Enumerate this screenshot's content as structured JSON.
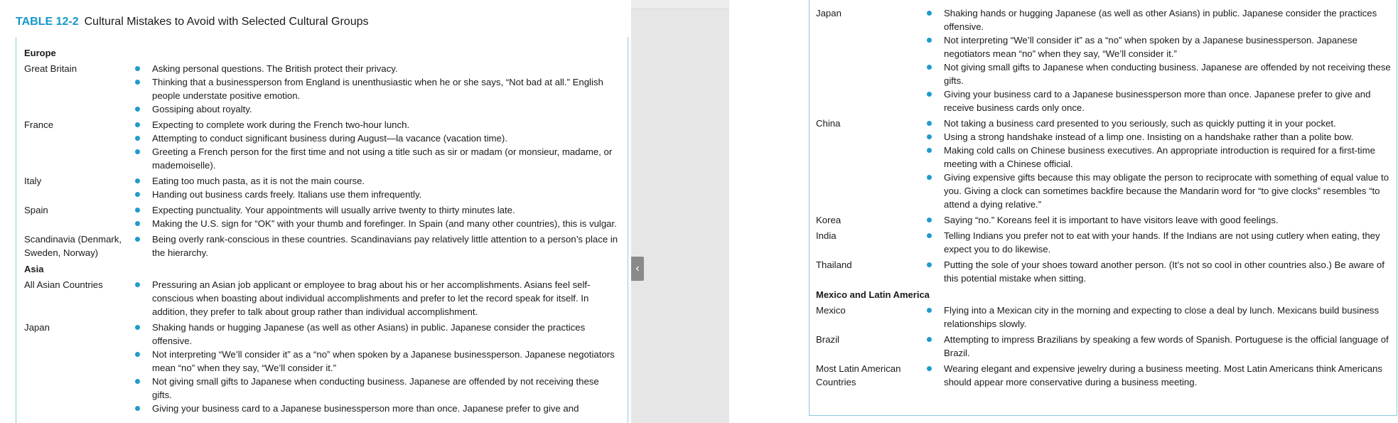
{
  "colors": {
    "accent": "#1597c8",
    "bullet": "#1e9ccc",
    "frame": "#8fc9dd",
    "gutter": "#e6e6e6"
  },
  "table": {
    "number": "TABLE 12-2",
    "title": "Cultural Mistakes to Avoid with Selected Cultural Groups"
  },
  "collapse_icon": "chevron-left-icon",
  "left_page": [
    {
      "section": "Europe"
    },
    {
      "country": "Great Britain",
      "items": [
        "Asking personal questions. The British protect their privacy.",
        "Thinking that a businessperson from England is unenthusiastic when he or she says, “Not bad at all.” English people understate positive emotion.",
        "Gossiping about royalty."
      ]
    },
    {
      "country": "France",
      "items": [
        "Expecting to complete work during the French two-hour lunch.",
        "Attempting to conduct significant business during August—la vacance (vacation time).",
        "Greeting a French person for the first time and not using a title such as sir or madam (or monsieur, madame, or mademoiselle)."
      ]
    },
    {
      "country": "Italy",
      "items": [
        "Eating too much pasta, as it is not the main course.",
        "Handing out business cards freely. Italians use them infrequently."
      ]
    },
    {
      "country": "Spain",
      "items": [
        "Expecting punctuality. Your appointments will usually arrive twenty to thirty minutes late.",
        "Making the U.S. sign for “OK” with your thumb and forefinger. In Spain (and many other countries), this is vulgar."
      ]
    },
    {
      "country": "Scandinavia (Denmark, Sweden, Norway)",
      "items": [
        "Being overly rank-conscious in these countries. Scandinavians pay relatively little attention to a person’s place in the hierarchy."
      ]
    },
    {
      "section": "Asia"
    },
    {
      "country": "All Asian Countries",
      "items": [
        "Pressuring an Asian job applicant or employee to brag about his or her accomplishments. Asians feel self-conscious when boasting about individual accomplishments and prefer to let the record speak for itself. In addition, they prefer to talk about group rather than individual accomplishment."
      ]
    },
    {
      "country": "Japan",
      "items": [
        "Shaking hands or hugging Japanese (as well as other Asians) in public. Japanese consider the practices offensive.",
        "Not interpreting “We’ll consider it” as a “no” when spoken by a Japanese businessperson. Japanese negotiators mean “no” when they say, “We’ll consider it.”",
        "Not giving small gifts to Japanese when conducting business. Japanese are offended by not receiving these gifts.",
        "Giving your business card to a Japanese businessperson more than once. Japanese prefer to give and"
      ]
    }
  ],
  "right_page": [
    {
      "country": "Japan",
      "items": [
        "Shaking hands or hugging Japanese (as well as other Asians) in public. Japanese consider the practices offensive.",
        "Not interpreting “We’ll consider it” as a “no” when spoken by a Japanese businessperson. Japanese negotiators mean “no” when they say, “We’ll consider it.”",
        "Not giving small gifts to Japanese when conducting business. Japanese are offended by not receiving these gifts.",
        "Giving your business card to a Japanese businessperson more than once. Japanese prefer to give and receive business cards only once."
      ]
    },
    {
      "country": "China",
      "items": [
        "Not taking a business card presented to you seriously, such as quickly putting it in your pocket.",
        "Using a strong handshake instead of a limp one. Insisting on a handshake rather than a polite bow.",
        "Making cold calls on Chinese business executives. An appropriate introduction is required for a first-time meeting with a Chinese official.",
        "Giving expensive gifts because this may obligate the person to reciprocate with something of equal value to you. Giving a clock can sometimes backfire because the Mandarin word for “to give clocks” resembles “to attend a dying relative.”"
      ]
    },
    {
      "country": "Korea",
      "items": [
        "Saying “no.” Koreans feel it is important to have visitors leave with good feelings."
      ]
    },
    {
      "country": "India",
      "items": [
        "Telling Indians you prefer not to eat with your hands. If the Indians are not using cutlery when eating, they expect you to do likewise."
      ]
    },
    {
      "country": "Thailand",
      "items": [
        "Putting the sole of your shoes toward another person. (It’s not so cool in other countries also.) Be aware of this potential mistake when sitting."
      ]
    },
    {
      "section": "Mexico and Latin America"
    },
    {
      "country": "Mexico",
      "items": [
        "Flying into a Mexican city in the morning and expecting to close a deal by lunch. Mexicans build business relationships slowly."
      ]
    },
    {
      "country": "Brazil",
      "items": [
        "Attempting to impress Brazilians by speaking a few words of Spanish. Portuguese is the official language of Brazil."
      ]
    },
    {
      "country": "Most Latin American Countries",
      "items": [
        "Wearing elegant and expensive jewelry during a business meeting. Most Latin Americans think Americans should appear more conservative during a business meeting."
      ]
    }
  ]
}
